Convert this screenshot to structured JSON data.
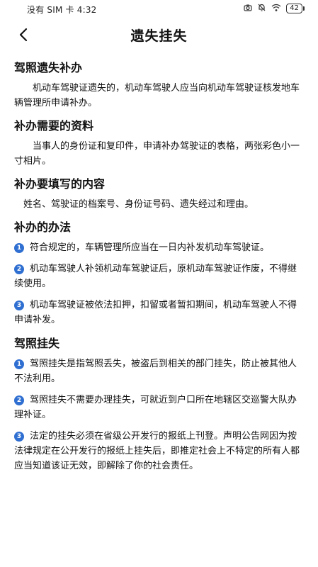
{
  "status_bar": {
    "left_text": "没有 SIM 卡 4:32",
    "battery": "42",
    "icons": [
      "camera-icon",
      "bell-off-icon",
      "wifi-icon"
    ]
  },
  "header": {
    "back_icon": "chevron-left-icon",
    "title": "遗失挂失"
  },
  "sections": [
    {
      "heading": "驾照遗失补办",
      "paragraph": "机动车驾驶证遗失的，机动车驾驶人应当向机动车驾驶证核发地车辆管理所申请补办。"
    },
    {
      "heading": "补办需要的资料",
      "paragraph": "当事人的身份证和复印件，申请补办驾驶证的表格，两张彩色小一寸相片。"
    },
    {
      "heading": "补办要填写的内容",
      "paragraph": "姓名、驾驶证的档案号、身份证号码、遗失经过和理由。"
    },
    {
      "heading": "补办的办法",
      "items": [
        {
          "num": "1",
          "text": "符合规定的，车辆管理所应当在一日内补发机动车驾驶证。"
        },
        {
          "num": "2",
          "text": "机动车驾驶人补领机动车驾驶证后，原机动车驾驶证作废，不得继续使用。"
        },
        {
          "num": "3",
          "text": "机动车驾驶证被依法扣押，扣留或者暂扣期间，机动车驾驶人不得申请补发。"
        }
      ]
    },
    {
      "heading": "驾照挂失",
      "items": [
        {
          "num": "1",
          "text": "驾照挂失是指驾照丢失，被盗后到相关的部门挂失，防止被其他人不法利用。"
        },
        {
          "num": "2",
          "text": "驾照挂失不需要办理挂失，可就近到户口所在地辖区交巡警大队办理补证。"
        },
        {
          "num": "3",
          "text": "法定的挂失必须在省级公开发行的报纸上刊登。声明公告网因为按法律规定在公开发行的报纸上挂失后，即推定社会上不特定的所有人都应当知道该证无效，即解除了你的社会责任。"
        }
      ]
    }
  ],
  "colors": {
    "badge": "#2f6fd1",
    "text": "#111111",
    "background": "#ffffff"
  }
}
